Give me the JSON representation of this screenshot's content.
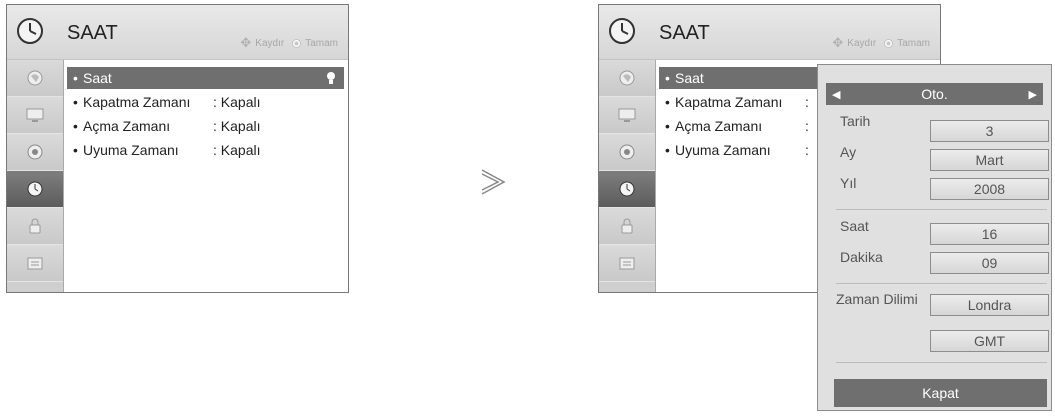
{
  "left_panel": {
    "title": "SAAT",
    "hint_move": "Kaydır",
    "hint_ok": "Tamam",
    "menu": [
      {
        "label": "Saat",
        "value": ""
      },
      {
        "label": "Kapatma Zamanı",
        "value": ": Kapalı"
      },
      {
        "label": "Açma Zamanı",
        "value": ": Kapalı"
      },
      {
        "label": "Uyuma Zamanı",
        "value": ": Kapalı"
      }
    ]
  },
  "right_panel": {
    "title": "SAAT",
    "hint_move": "Kaydır",
    "hint_ok": "Tamam",
    "menu": [
      {
        "label": "Saat",
        "value": ""
      },
      {
        "label": "Kapatma Zamanı",
        "value": ":"
      },
      {
        "label": "Açma Zamanı",
        "value": ":"
      },
      {
        "label": "Uyuma Zamanı",
        "value": ":"
      }
    ]
  },
  "sidebar_icons": [
    "picture-icon",
    "screen-icon",
    "audio-icon",
    "clock-icon",
    "lock-icon",
    "option-icon"
  ],
  "popup": {
    "mode": "Oto.",
    "fields": [
      {
        "label": "Tarih",
        "value": "3"
      },
      {
        "label": "Ay",
        "value": "Mart"
      },
      {
        "label": "Yıl",
        "value": "2008"
      },
      {
        "label": "Saat",
        "value": "16"
      },
      {
        "label": "Dakika",
        "value": "09"
      },
      {
        "label": "Zaman Dilimi",
        "value": "Londra"
      },
      {
        "label": "",
        "value": "GMT"
      }
    ],
    "close_label": "Kapat"
  },
  "colors": {
    "selected_bg": "#6f6f6f",
    "sidebar_bg": "#cfcfcf",
    "titlebar_bg": "#dcdcdc"
  }
}
